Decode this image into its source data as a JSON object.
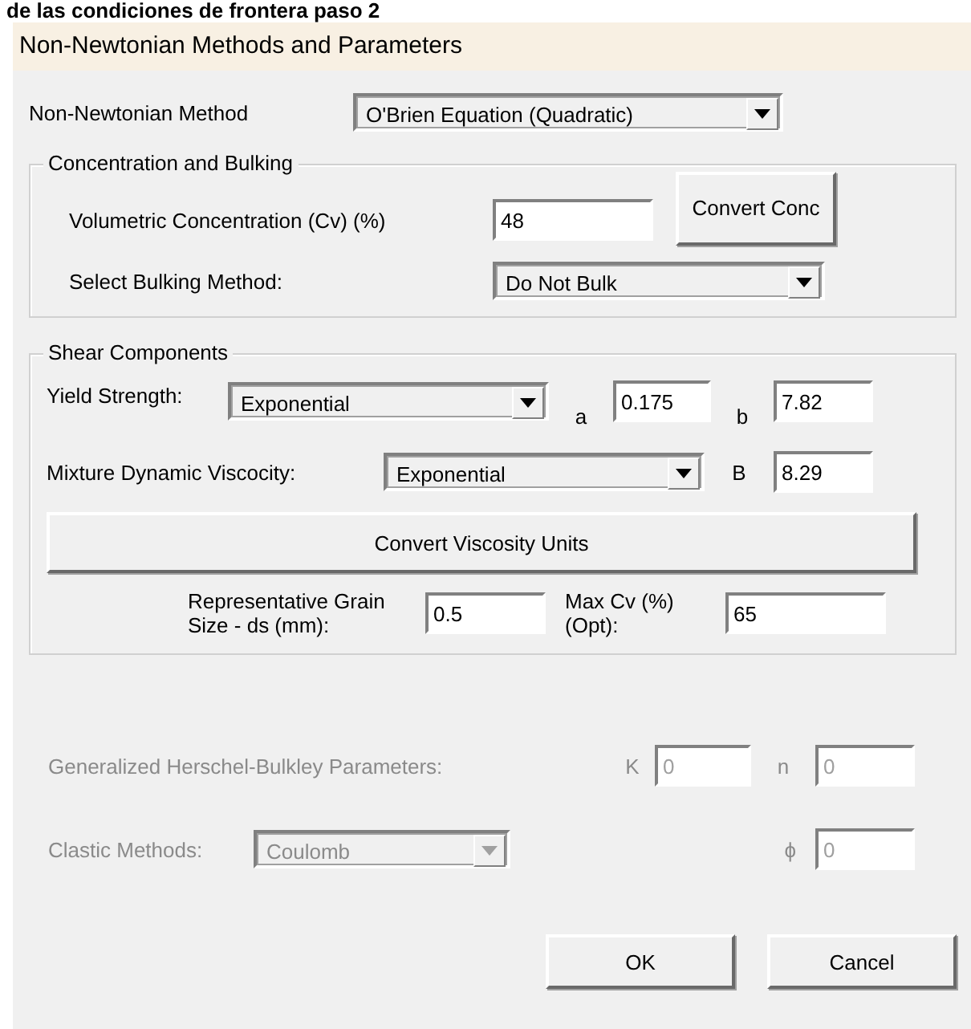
{
  "caption": "de las condiciones de frontera paso 2",
  "window": {
    "title": "Non-Newtonian Methods and Parameters"
  },
  "method": {
    "label": "Non-Newtonian Method",
    "value": "O'Brien Equation (Quadratic)"
  },
  "concentration": {
    "legend": "Concentration and Bulking",
    "cv_label": "Volumetric Concentration (Cv) (%)",
    "cv_value": "48",
    "convert_button": "Convert Conc",
    "bulking_label": "Select Bulking Method:",
    "bulking_value": "Do Not Bulk"
  },
  "shear": {
    "legend": "Shear Components",
    "yield_label": "Yield Strength:",
    "yield_method": "Exponential",
    "a_label": "a",
    "a_value": "0.175",
    "b_label": "b",
    "b_value": "7.82",
    "viscosity_label": "Mixture Dynamic Viscocity:",
    "viscosity_method": "Exponential",
    "B_label": "B",
    "B_value": "8.29",
    "convert_button": "Convert Viscosity Units",
    "grain_label": "Representative Grain Size - ds (mm):",
    "grain_value": "0.5",
    "maxcv_label": "Max Cv (%) (Opt):",
    "maxcv_value": "65"
  },
  "herschel": {
    "disabled": true,
    "label": "Generalized Herschel-Bulkley Parameters:",
    "k_label": "K",
    "k_value": "0",
    "n_label": "n",
    "n_value": "0"
  },
  "clastic": {
    "disabled": true,
    "label": "Clastic Methods:",
    "method": "Coulomb",
    "phi_label": "ϕ",
    "phi_value": "0"
  },
  "buttons": [
    "OK",
    "Cancel"
  ]
}
